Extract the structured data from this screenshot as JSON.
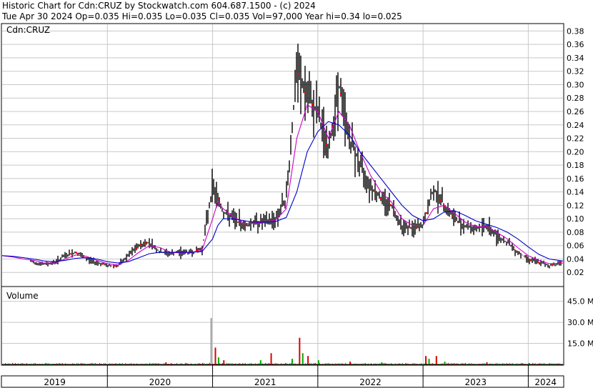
{
  "header": {
    "line1": "Historic Chart for Cdn:CRUZ by Stockwatch.com 604.687.1500 - (c) 2024",
    "line2": "Tue Apr 30 2024  Op=0.035  Hi=0.035  Lo=0.035  Cl=0.035  Vol=97,000  Year hi=0.34  lo=0.025"
  },
  "colors": {
    "price": "#000000",
    "ma_short": "#cc00cc",
    "ma_long": "#0000cc",
    "up_dot": "#ff0000",
    "vol_red": "#dd0000",
    "vol_green": "#00aa00",
    "vol_gray": "#999999",
    "grid": "#c8c8c8"
  },
  "chart_data": {
    "type": "line",
    "title": "Historic Chart for Cdn:CRUZ by Stockwatch.com 604.687.1500 - (c) 2024",
    "price_panel": {
      "label": "Cdn:CRUZ",
      "ylim": [
        0,
        0.39
      ],
      "yticks": [
        "0.02",
        "0.04",
        "0.06",
        "0.08",
        "0.10",
        "0.12",
        "0.14",
        "0.16",
        "0.18",
        "0.20",
        "0.22",
        "0.24",
        "0.26",
        "0.28",
        "0.30",
        "0.32",
        "0.34",
        "0.36",
        "0.38"
      ],
      "grid": true,
      "x": [
        2019.0,
        2019.1,
        2019.2,
        2019.3,
        2019.4,
        2019.5,
        2019.6,
        2019.7,
        2019.8,
        2019.9,
        2020.0,
        2020.1,
        2020.2,
        2020.3,
        2020.4,
        2020.5,
        2020.6,
        2020.7,
        2020.8,
        2020.9,
        2021.0,
        2021.05,
        2021.1,
        2021.2,
        2021.3,
        2021.4,
        2021.5,
        2021.6,
        2021.7,
        2021.8,
        2021.9,
        2022.0,
        2022.1,
        2022.2,
        2022.3,
        2022.4,
        2022.5,
        2022.6,
        2022.7,
        2022.8,
        2022.9,
        2023.0,
        2023.1,
        2023.2,
        2023.3,
        2023.4,
        2023.5,
        2023.6,
        2023.7,
        2023.8,
        2023.9,
        2024.0,
        2024.1,
        2024.2,
        2024.33
      ],
      "series": [
        {
          "values": [
            0.045,
            0.04,
            0.04,
            0.035,
            0.032,
            0.035,
            0.045,
            0.05,
            0.04,
            0.035,
            0.03,
            0.03,
            0.045,
            0.06,
            0.065,
            0.05,
            0.048,
            0.05,
            0.05,
            0.055,
            0.15,
            0.13,
            0.11,
            0.1,
            0.09,
            0.095,
            0.095,
            0.1,
            0.13,
            0.32,
            0.28,
            0.26,
            0.2,
            0.3,
            0.22,
            0.18,
            0.15,
            0.13,
            0.12,
            0.09,
            0.085,
            0.09,
            0.145,
            0.12,
            0.1,
            0.09,
            0.085,
            0.09,
            0.075,
            0.065,
            0.05,
            0.04,
            0.035,
            0.03,
            0.035
          ]
        },
        {
          "values": [
            0.045,
            0.043,
            0.04,
            0.038,
            0.034,
            0.034,
            0.04,
            0.046,
            0.044,
            0.038,
            0.033,
            0.031,
            0.038,
            0.05,
            0.06,
            0.057,
            0.05,
            0.049,
            0.05,
            0.053,
            0.1,
            0.125,
            0.115,
            0.103,
            0.093,
            0.093,
            0.095,
            0.098,
            0.115,
            0.22,
            0.27,
            0.26,
            0.22,
            0.26,
            0.24,
            0.2,
            0.165,
            0.14,
            0.125,
            0.1,
            0.09,
            0.09,
            0.115,
            0.12,
            0.108,
            0.095,
            0.088,
            0.089,
            0.08,
            0.07,
            0.057,
            0.045,
            0.038,
            0.033,
            0.034
          ]
        },
        {
          "values": [
            0.045,
            0.044,
            0.042,
            0.04,
            0.037,
            0.036,
            0.038,
            0.041,
            0.042,
            0.04,
            0.036,
            0.034,
            0.036,
            0.042,
            0.048,
            0.05,
            0.05,
            0.05,
            0.05,
            0.051,
            0.07,
            0.09,
            0.1,
            0.1,
            0.097,
            0.095,
            0.095,
            0.096,
            0.102,
            0.14,
            0.2,
            0.23,
            0.245,
            0.24,
            0.225,
            0.2,
            0.18,
            0.16,
            0.14,
            0.12,
            0.105,
            0.097,
            0.1,
            0.11,
            0.112,
            0.105,
            0.097,
            0.092,
            0.087,
            0.08,
            0.07,
            0.058,
            0.047,
            0.04,
            0.037
          ]
        }
      ]
    },
    "volume_panel": {
      "label": "Volume",
      "ylim": [
        0,
        55
      ],
      "yticks": [
        "15.0 M",
        "30.0 M",
        "45.0 M"
      ],
      "spikes": [
        {
          "x": 2020.55,
          "value": 1.5
        },
        {
          "x": 2020.98,
          "value": 33
        },
        {
          "x": 2021.02,
          "value": 12
        },
        {
          "x": 2021.05,
          "value": 5
        },
        {
          "x": 2021.1,
          "value": 3
        },
        {
          "x": 2021.45,
          "value": 3
        },
        {
          "x": 2021.55,
          "value": 8
        },
        {
          "x": 2021.75,
          "value": 4
        },
        {
          "x": 2021.82,
          "value": 19
        },
        {
          "x": 2021.85,
          "value": 8
        },
        {
          "x": 2021.9,
          "value": 6
        },
        {
          "x": 2022.0,
          "value": 3
        },
        {
          "x": 2022.3,
          "value": 2
        },
        {
          "x": 2022.6,
          "value": 1.5
        },
        {
          "x": 2023.02,
          "value": 6
        },
        {
          "x": 2023.05,
          "value": 4
        },
        {
          "x": 2023.12,
          "value": 6
        },
        {
          "x": 2023.2,
          "value": 2
        },
        {
          "x": 2023.6,
          "value": 1.5
        },
        {
          "x": 2024.0,
          "value": 1
        }
      ]
    },
    "x_axis": {
      "labels": [
        {
          "text": "2019",
          "x": 2019.0
        },
        {
          "text": "2020",
          "x": 2020.0
        },
        {
          "text": "2021",
          "x": 2021.0
        },
        {
          "text": "2022",
          "x": 2022.0
        },
        {
          "text": "2023",
          "x": 2023.0
        },
        {
          "text": "2024",
          "x": 2024.0
        }
      ]
    }
  }
}
